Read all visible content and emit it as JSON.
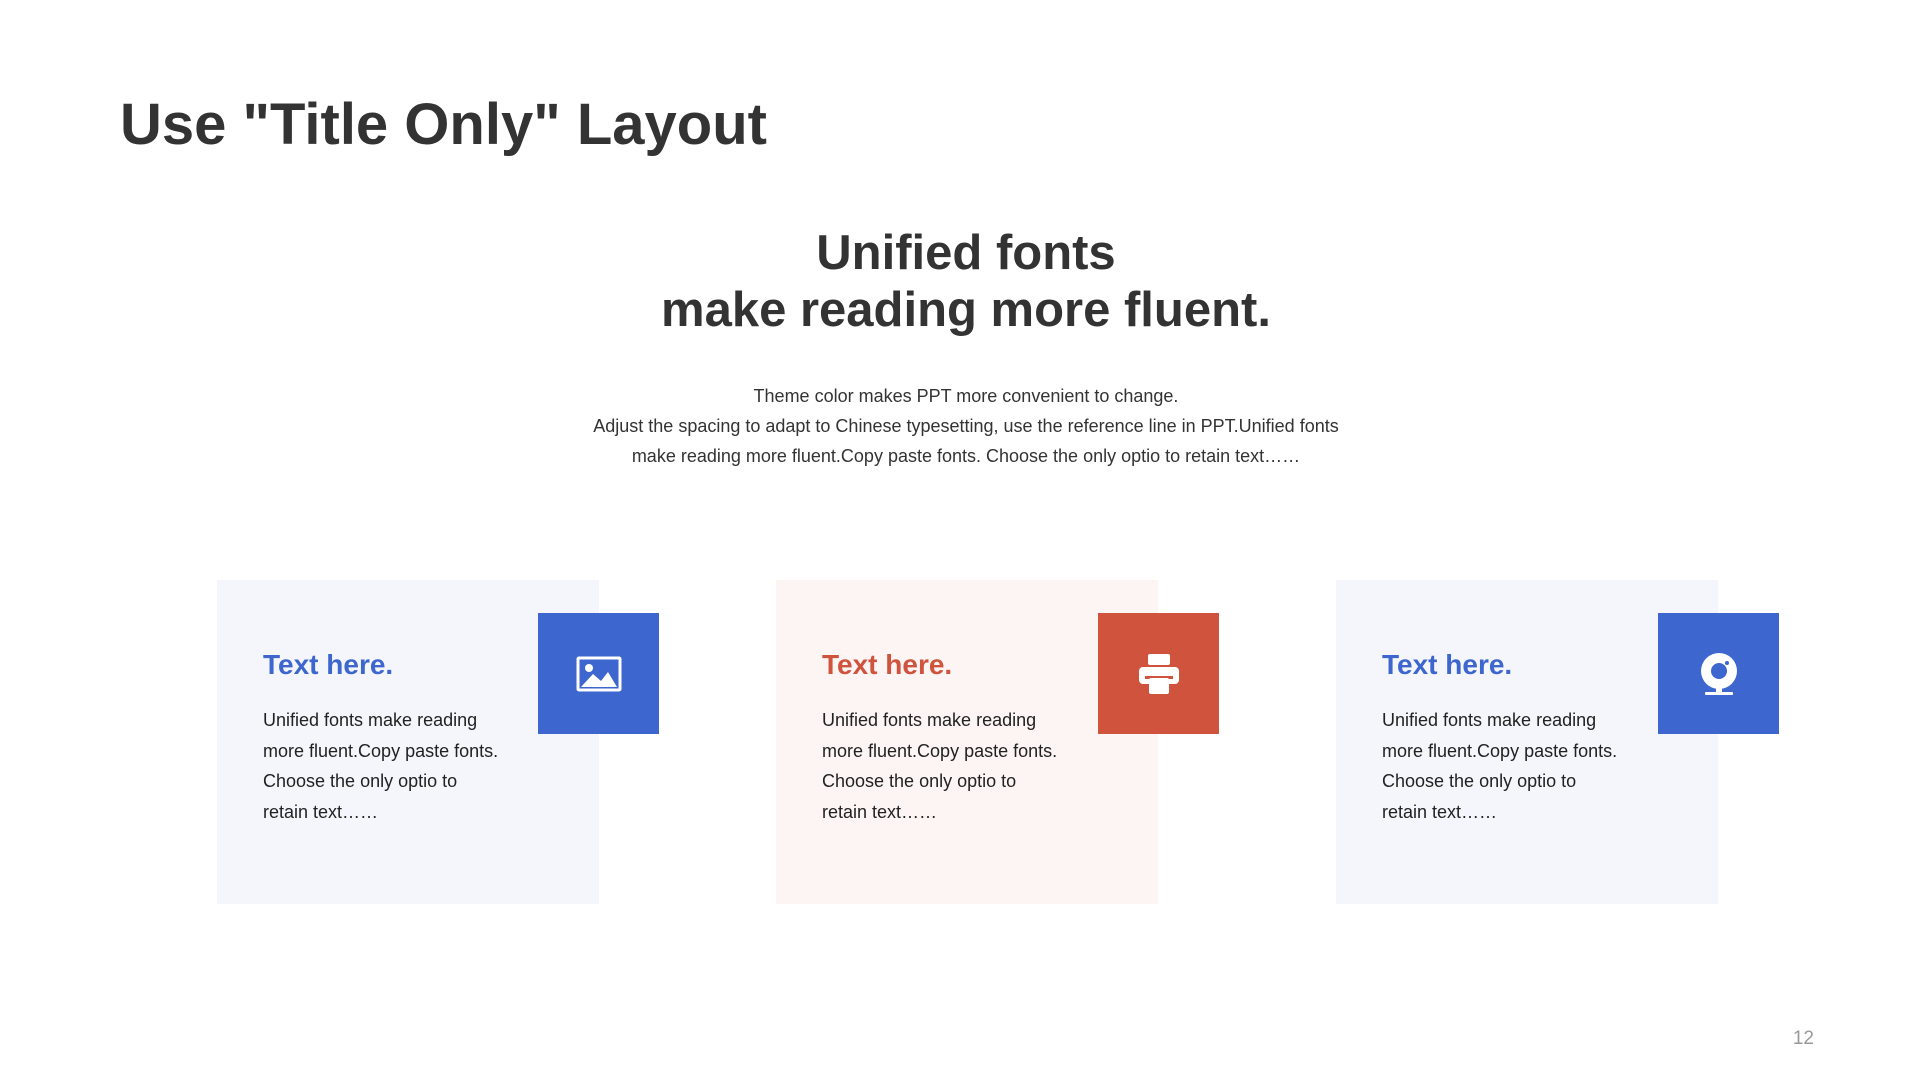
{
  "title": "Use \"Title Only\" Layout",
  "headline": {
    "line1": "Unified fonts",
    "line2": "make reading more fluent."
  },
  "intro": {
    "line1": "Theme  color makes PPT more convenient to change.",
    "line2": "Adjust the spacing to adapt to Chinese typesetting, use the reference line in PPT.Unified fonts",
    "line3": "make reading more fluent.Copy paste fonts. Choose the only optio to retain text……"
  },
  "colors": {
    "blue": "#3d66cf",
    "red": "#d0533e",
    "card_blue_bg": "#f5f6fb",
    "card_red_bg": "#fdf5f3"
  },
  "cards": [
    {
      "title": "Text here.",
      "lines": [
        "Unified fonts make reading",
        "more fluent.Copy paste fonts.",
        "Choose the only optio to",
        "retain text……"
      ],
      "icon": "image-icon",
      "accent": "blue"
    },
    {
      "title": "Text here.",
      "lines": [
        "Unified fonts make reading",
        "more fluent.Copy paste fonts.",
        "Choose the only optio to",
        "retain text……"
      ],
      "icon": "printer-icon",
      "accent": "red"
    },
    {
      "title": "Text here.",
      "lines": [
        "Unified fonts make reading",
        "more fluent.Copy paste fonts.",
        "Choose the only optio to",
        "retain text……"
      ],
      "icon": "webcam-icon",
      "accent": "blue"
    }
  ],
  "page_number": "12"
}
